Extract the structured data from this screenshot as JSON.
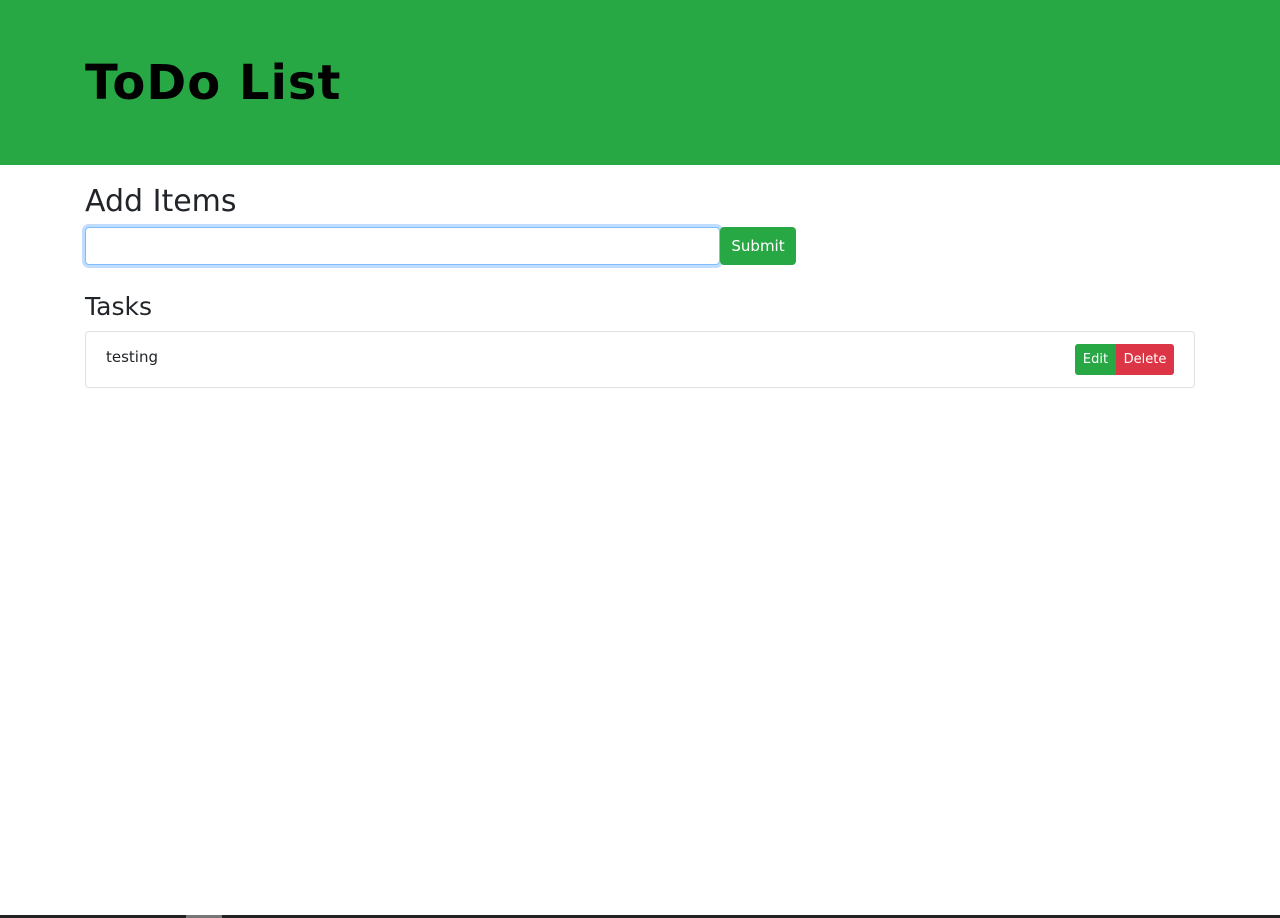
{
  "header": {
    "title": "ToDo List",
    "color": "#28a745"
  },
  "add_section": {
    "title": "Add Items",
    "input_value": "",
    "input_placeholder": "",
    "submit_label": "Submit"
  },
  "tasks_section": {
    "title": "Tasks",
    "items": [
      {
        "text": "testing",
        "edit_label": "Edit",
        "delete_label": "Delete"
      }
    ]
  },
  "colors": {
    "success": "#28a745",
    "danger": "#dc3545"
  }
}
